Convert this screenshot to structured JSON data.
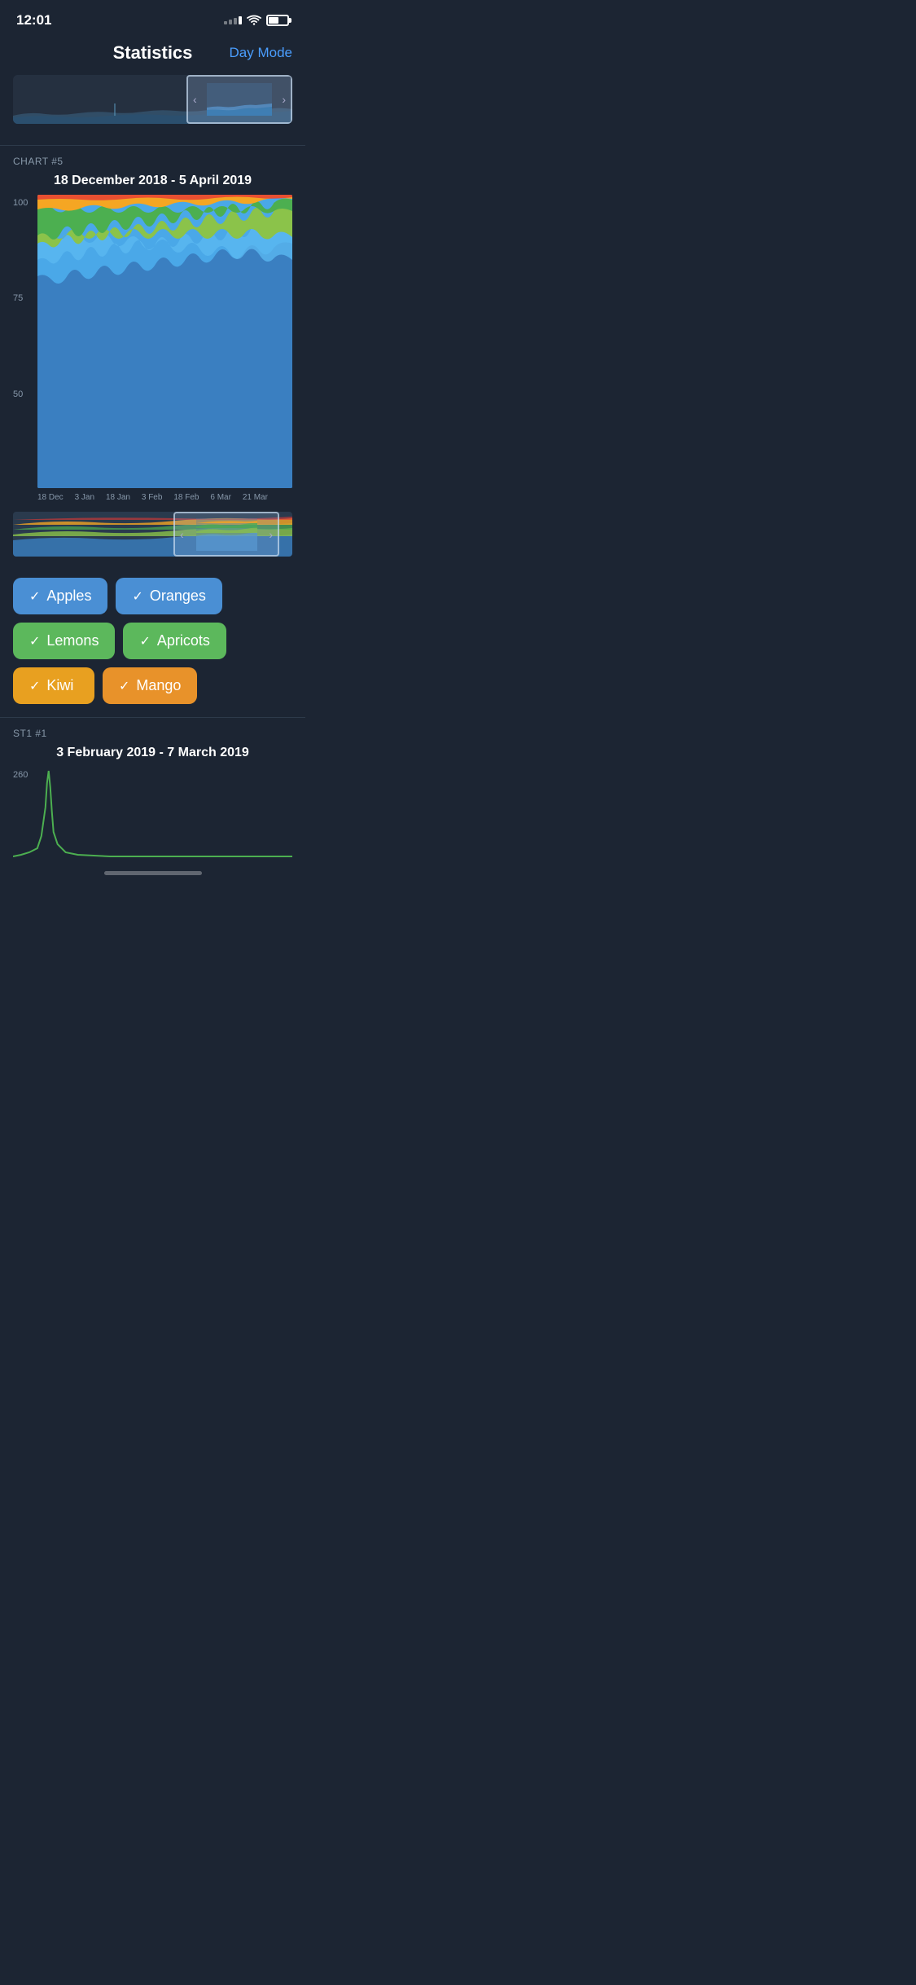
{
  "statusBar": {
    "time": "12:01"
  },
  "header": {
    "title": "Statistics",
    "dayModeLabel": "Day Mode"
  },
  "chart5": {
    "label": "CHART #5",
    "dateRange": "18 December 2018 - 5 April 2019",
    "yLabels": [
      "100",
      "75",
      "50"
    ],
    "xLabels": [
      "18 Dec",
      "3 Jan",
      "18 Jan",
      "3 Feb",
      "18 Feb",
      "6 Mar",
      "21 Mar"
    ],
    "colors": {
      "blue": "#3a7fc1",
      "lightBlue": "#5cb8e8",
      "green": "#4caf50",
      "lightGreen": "#8bc34a",
      "orange": "#ff9800",
      "red": "#e53935"
    }
  },
  "filterButtons": [
    {
      "label": "Apples",
      "color": "btn-blue",
      "checked": true
    },
    {
      "label": "Oranges",
      "color": "btn-blue2",
      "checked": true
    },
    {
      "label": "Lemons",
      "color": "btn-green",
      "checked": true
    },
    {
      "label": "Apricots",
      "color": "btn-green2",
      "checked": true
    },
    {
      "label": "Kiwi",
      "color": "btn-yellow",
      "checked": true
    },
    {
      "label": "Mango",
      "color": "btn-orange",
      "checked": true
    }
  ],
  "section2": {
    "label": "ST1 #1",
    "dateRange": "3 February 2019 - 7 March 2019",
    "yLabel": "260"
  }
}
